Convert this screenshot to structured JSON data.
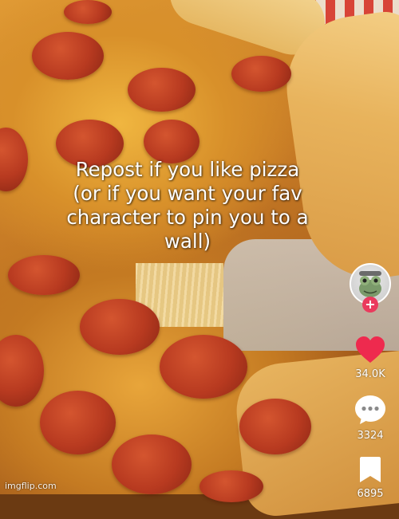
{
  "post": {
    "caption_lines": [
      "Repost if you like pizza",
      "(or if you want your fav",
      "character to pin you to a",
      "wall)"
    ]
  },
  "sidebar": {
    "avatar_icon": "frog-avatar-icon",
    "follow_label": "+",
    "like": {
      "icon": "heart-icon",
      "count": "34.0K",
      "color": "#ee2a4e"
    },
    "comment": {
      "icon": "comment-bubble-icon",
      "count": "3324"
    },
    "bookmark": {
      "icon": "bookmark-icon",
      "count": "6895"
    }
  },
  "watermark": "imgflip.com",
  "colors": {
    "accent": "#ea3a5d",
    "text": "#ffffff"
  }
}
